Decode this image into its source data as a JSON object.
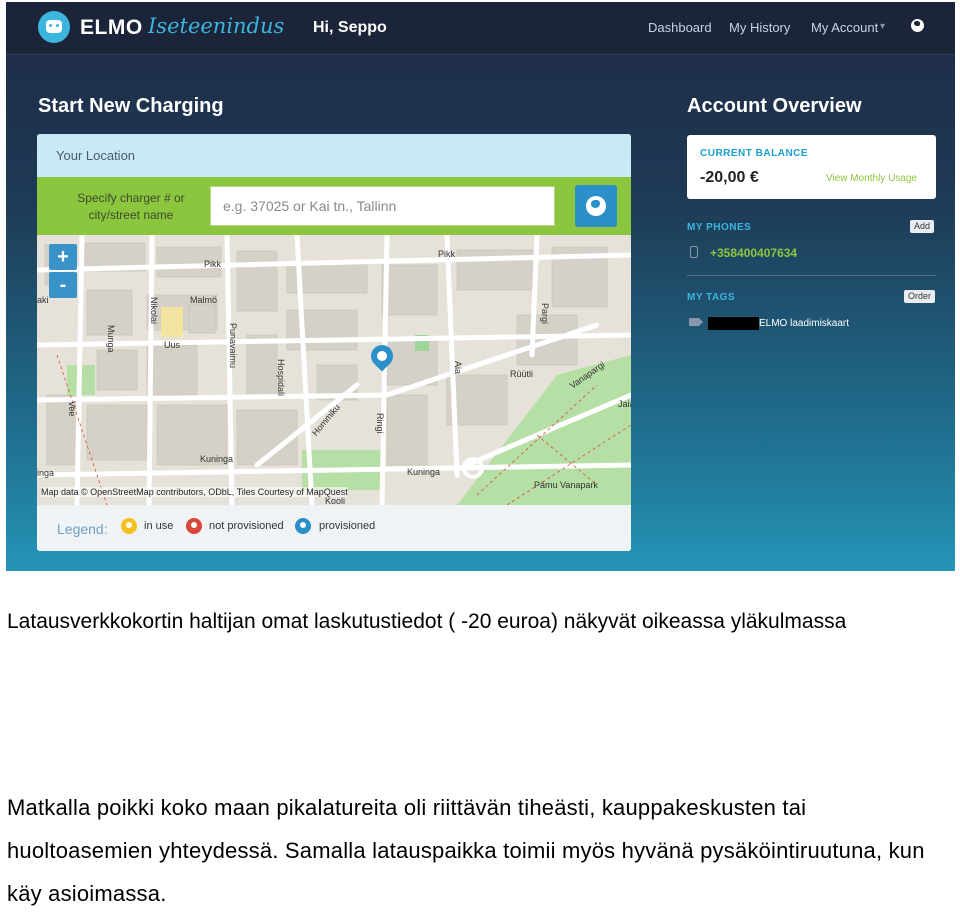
{
  "topbar": {
    "brand": "ELMO",
    "brand_sub": "Iseteenindus",
    "greeting": "Hi, Seppo",
    "nav": [
      "Dashboard",
      "My History",
      "My Account"
    ],
    "nav_caret": "▾"
  },
  "charging": {
    "title": "Start New Charging",
    "location_title": "Your Location",
    "search_label": "Specify charger # or city/street name",
    "search_placeholder": "e.g. 37025 or Kai tn., Tallinn",
    "zoom_in": "+",
    "zoom_out": "-",
    "streets": [
      "Pikk",
      "Malmö",
      "Uus",
      "Nikolai",
      "Munga",
      "Punavaimu",
      "Hospidali",
      "Hommiku",
      "Ringi",
      "Pargi",
      "Aia",
      "Rüütli",
      "Vanapargi",
      "Kuninga",
      "Vee",
      "Kuninga",
      "Pämu Vanapark",
      "Rüütli",
      "Pikk",
      "Jaia",
      "Kooli",
      "aki",
      "inga"
    ],
    "map_attribution": "Map data © OpenStreetMap contributors, ODbL, Tiles Courtesy of MapQuest",
    "legend_title": "Legend:",
    "legend": [
      {
        "label": "in use",
        "color": "#f3c020"
      },
      {
        "label": "not provisioned",
        "color": "#d9463a"
      },
      {
        "label": "provisioned",
        "color": "#2b8fc9"
      }
    ]
  },
  "account": {
    "title": "Account Overview",
    "balance_label": "CURRENT BALANCE",
    "balance_value": "-20,00 €",
    "monthly_link": "View Monthly Usage",
    "phones_label": "MY PHONES",
    "add_button": "Add",
    "phone": "+358400407634",
    "tags_label": "MY TAGS",
    "order_button": "Order",
    "tag": "ELMO laadimiskaart"
  },
  "caption": {
    "p1": "Latausverkkokortin haltijan omat laskutustiedot ( -20 euroa) näkyvät oikeassa yläkulmassa",
    "p2": "Matkalla poikki koko maan pikalatureita oli riittävän tiheästi, kauppakeskusten tai huoltoasemien yhteydessä. Samalla latauspaikka toimii myös hyvänä pysäköintiruutuna, kun käy asioimassa."
  },
  "colors": {
    "brand_blue": "#3cb6df",
    "green": "#8cc63f",
    "topbar": "#1b2438"
  }
}
